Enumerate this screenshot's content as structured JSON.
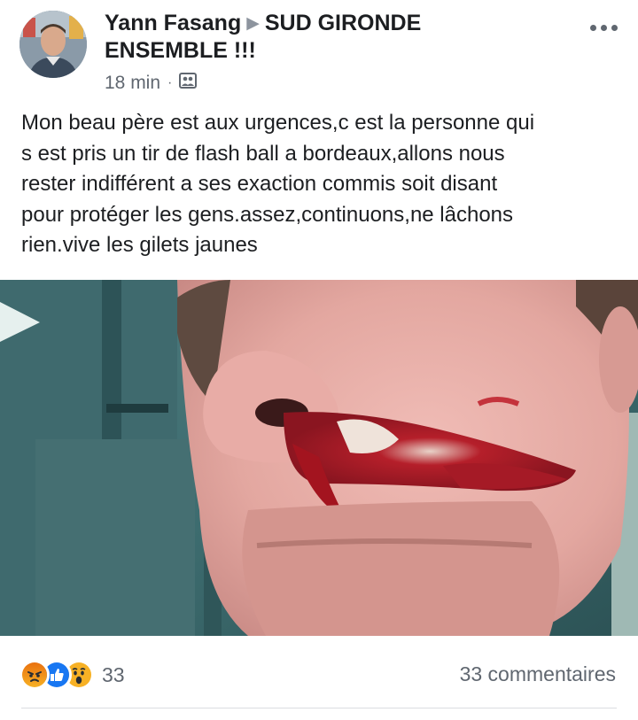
{
  "post": {
    "author": "Yann Fasang",
    "group_line1": "SUD GIRONDE",
    "group_line2": "ENSEMBLE !!!",
    "time": "18 min",
    "audience_icon": "group-audience-icon",
    "body": "Mon beau père est aux urgences,c est la personne qui\ns est pris un tir de flash ball a bordeaux,allons nous\nrester indifférent a ses exaction commis soit disant\npour protéger les gens.assez,continuons,ne lâchons\nrien.vive les gilets jaunes",
    "more_icon": "more-options-icon"
  },
  "footer": {
    "reactions": [
      "angry",
      "like",
      "wow"
    ],
    "reaction_count": "33",
    "comments": "33 commentaires"
  },
  "colors": {
    "text": "#1c1e21",
    "secondary_text": "#606770",
    "like_blue": "#1877f2",
    "reaction_yellow": "#f7b125",
    "angry_red": "#e9710f"
  }
}
